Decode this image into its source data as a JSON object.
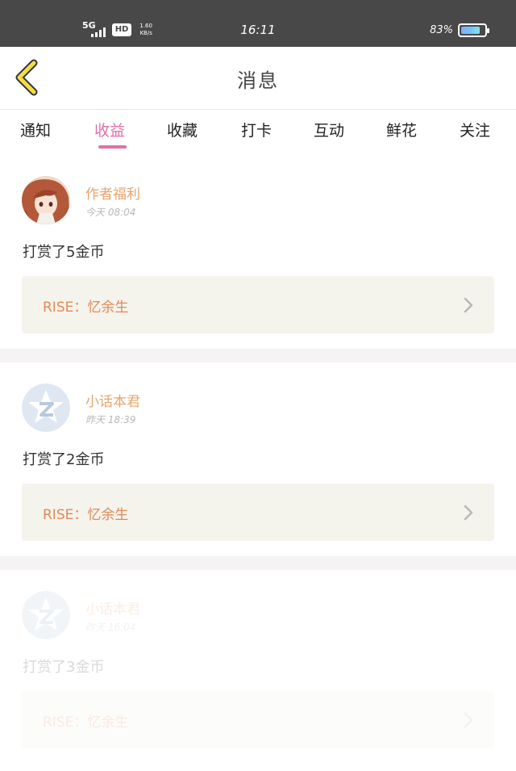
{
  "status_bar": {
    "network": "5G",
    "hd": "HD",
    "speed_value": "1.60",
    "speed_unit": "KB/s",
    "time": "16:11",
    "battery_percent": "83%",
    "battery_level": 0.83
  },
  "header": {
    "title": "消息",
    "back_icon": "chevron-left-icon"
  },
  "tabs": [
    {
      "label": "通知",
      "active": false
    },
    {
      "label": "收益",
      "active": true
    },
    {
      "label": "收藏",
      "active": false
    },
    {
      "label": "打卡",
      "active": false
    },
    {
      "label": "互动",
      "active": false
    },
    {
      "label": "鲜花",
      "active": false
    },
    {
      "label": "关注",
      "active": false
    }
  ],
  "accent_color": "#e070a8",
  "messages": [
    {
      "sender": "作者福利",
      "time": "今天 08:04",
      "text": "打赏了5金币",
      "work": "RISE：忆余生",
      "avatar": "anime-avatar"
    },
    {
      "sender": "小话本君",
      "time": "昨天 18:39",
      "text": "打赏了2金币",
      "work": "RISE：忆余生",
      "avatar": "star-logo-avatar"
    },
    {
      "sender": "小话本君",
      "time": "昨天 16:04",
      "text": "打赏了3金币",
      "work": "RISE：忆余生",
      "avatar": "star-logo-avatar"
    }
  ]
}
